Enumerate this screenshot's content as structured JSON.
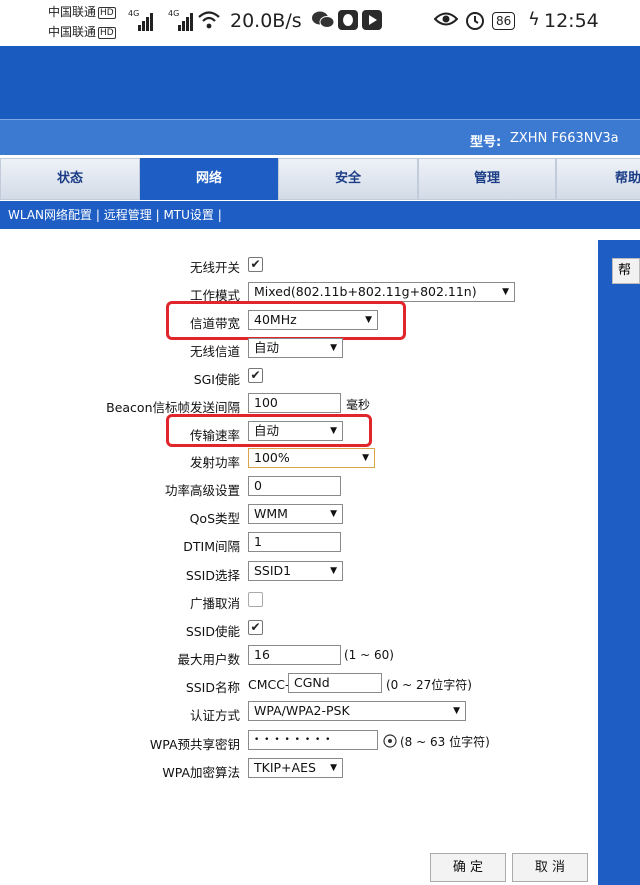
{
  "status_bar": {
    "carrier_1": "中国联通",
    "carrier_2": "中国联通",
    "hd": "HD",
    "net_1": "4G",
    "net_2": "4G",
    "speed": "20.0B/s",
    "battery": "86",
    "time": "12:54"
  },
  "header": {
    "model_label": "型号:",
    "model_value": "ZXHN F663NV3a"
  },
  "tabs": [
    {
      "label": "状态"
    },
    {
      "label": "网络"
    },
    {
      "label": "安全"
    },
    {
      "label": "管理"
    },
    {
      "label": "帮助"
    }
  ],
  "subnav": {
    "items": [
      "WLAN网络配置",
      "远程管理",
      "MTU设置"
    ],
    "separator": "|"
  },
  "help_button": "帮",
  "form": {
    "wireless_switch": {
      "label": "无线开关",
      "checked": true
    },
    "work_mode": {
      "label": "工作模式",
      "value": "Mixed(802.11b+802.11g+802.11n)"
    },
    "channel_bandwidth": {
      "label": "信道带宽",
      "value": "40MHz"
    },
    "wireless_channel": {
      "label": "无线信道",
      "value": "自动"
    },
    "sgi": {
      "label": "SGI使能",
      "checked": true
    },
    "beacon_interval": {
      "label": "Beacon信标帧发送间隔",
      "value": "100",
      "unit": "毫秒"
    },
    "tx_rate": {
      "label": "传输速率",
      "value": "自动"
    },
    "tx_power": {
      "label": "发射功率",
      "value": "100%"
    },
    "power_level": {
      "label": "功率高级设置",
      "value": "0"
    },
    "qos_type": {
      "label": "QoS类型",
      "value": "WMM"
    },
    "dtim": {
      "label": "DTIM间隔",
      "value": "1"
    },
    "ssid_select": {
      "label": "SSID选择",
      "value": "SSID1"
    },
    "broadcast_cancel": {
      "label": "广播取消",
      "checked": false
    },
    "ssid_enable": {
      "label": "SSID使能",
      "checked": true
    },
    "max_users": {
      "label": "最大用户数",
      "value": "16",
      "hint": "(1 ~ 60)"
    },
    "ssid_name": {
      "label": "SSID名称",
      "prefix": "CMCC-",
      "value": "CGNd",
      "hint": "(0 ~ 27位字符)"
    },
    "auth_mode": {
      "label": "认证方式",
      "value": "WPA/WPA2-PSK"
    },
    "wpa_psk": {
      "label": "WPA预共享密钥",
      "value": "• • • • • • • •",
      "hint": "(8 ~ 63 位字符)"
    },
    "wpa_encryption": {
      "label": "WPA加密算法",
      "value": "TKIP+AES"
    }
  },
  "buttons": {
    "confirm": "确 定",
    "cancel": "取 消"
  },
  "colors": {
    "header_blue": "#1a5bbf",
    "highlight_red": "#e0262b"
  },
  "icons": {
    "dropdown": "▼",
    "check": "✔",
    "eye": "eye-icon"
  }
}
